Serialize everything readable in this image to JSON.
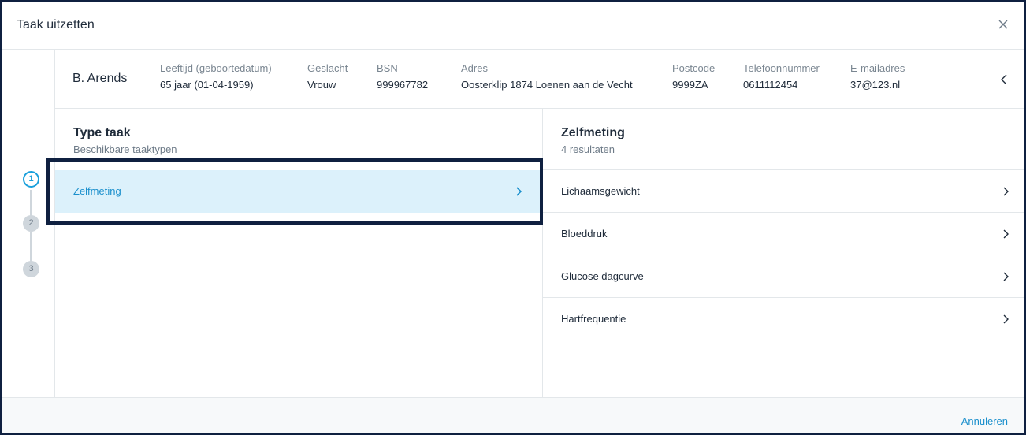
{
  "dialog": {
    "title": "Taak uitzetten"
  },
  "stepper": {
    "steps": [
      "1",
      "2",
      "3"
    ],
    "active_step": "1"
  },
  "patient": {
    "name": "B. Arends",
    "fields": [
      {
        "label": "Leeftijd (geboortedatum)",
        "value": "65 jaar (01-04-1959)"
      },
      {
        "label": "Geslacht",
        "value": "Vrouw"
      },
      {
        "label": "BSN",
        "value": "999967782"
      },
      {
        "label": "Adres",
        "value": "Oosterklip 1874 Loenen aan de Vecht"
      },
      {
        "label": "Postcode",
        "value": "9999ZA"
      },
      {
        "label": "Telefoonnummer",
        "value": "0611112454"
      },
      {
        "label": "E-mailadres",
        "value": "37@123.nl"
      }
    ]
  },
  "left_panel": {
    "title": "Type taak",
    "subtitle": "Beschikbare taaktypen",
    "items": [
      "Zelfmeting"
    ]
  },
  "right_panel": {
    "title": "Zelfmeting",
    "subtitle": "4 resultaten",
    "items": [
      "Lichaamsgewicht",
      "Bloeddruk",
      "Glucose dagcurve",
      "Hartfrequentie"
    ]
  },
  "footer": {
    "cancel_label": "Annuleren"
  },
  "colors": {
    "accent": "#1a8fcc",
    "selected_bg": "#dcf1fb",
    "highlight_border": "#0f2040"
  },
  "icons": {
    "close": "close-icon",
    "collapse": "chevron-left-icon",
    "item": "chevron-right-icon"
  }
}
